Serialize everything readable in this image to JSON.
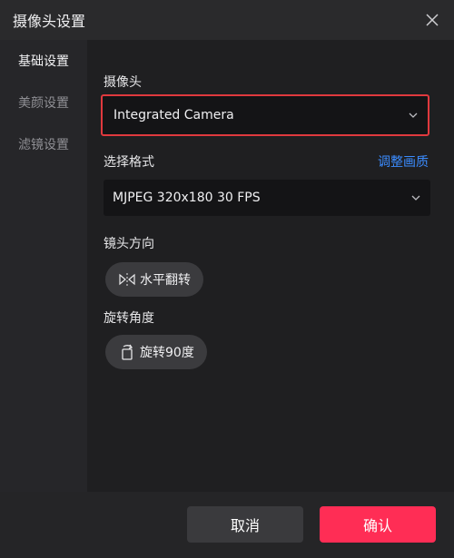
{
  "window": {
    "title": "摄像头设置"
  },
  "sidebar": {
    "items": [
      {
        "label": "基础设置",
        "active": true
      },
      {
        "label": "美颜设置",
        "active": false
      },
      {
        "label": "滤镜设置",
        "active": false
      }
    ]
  },
  "camera": {
    "label": "摄像头",
    "selected": "Integrated Camera"
  },
  "format": {
    "label": "选择格式",
    "adjust_link": "调整画质",
    "selected": "MJPEG 320x180 30 FPS"
  },
  "mirror": {
    "label": "镜头方向",
    "button": "水平翻转"
  },
  "rotate": {
    "label": "旋转角度",
    "button": "旋转90度"
  },
  "footer": {
    "cancel": "取消",
    "confirm": "确认"
  },
  "colors": {
    "accent": "#ff2d55",
    "link": "#3b8cff",
    "highlight_border": "#e0393e"
  }
}
